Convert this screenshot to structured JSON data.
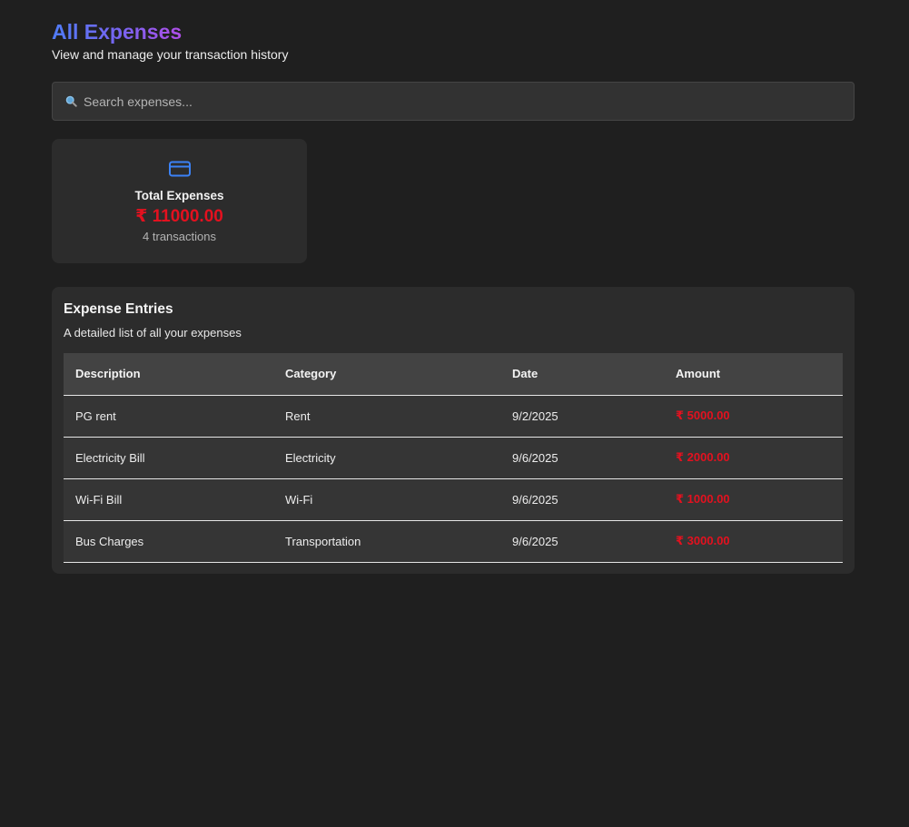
{
  "header": {
    "title": "All Expenses",
    "subtitle": "View and manage your transaction history"
  },
  "search": {
    "icon": "search-icon",
    "placeholder": "Search expenses..."
  },
  "summary": {
    "icon": "credit-card-icon",
    "title": "Total Expenses",
    "amount": "₹ 11000.00",
    "count": "4 transactions"
  },
  "entries": {
    "title": "Expense Entries",
    "subtitle": "A detailed list of all your expenses",
    "columns": [
      "Description",
      "Category",
      "Date",
      "Amount"
    ],
    "rows": [
      {
        "description": "PG rent",
        "category": "Rent",
        "date": "9/2/2025",
        "amount": "₹ 5000.00"
      },
      {
        "description": "Electricity Bill",
        "category": "Electricity",
        "date": "9/6/2025",
        "amount": "₹ 2000.00"
      },
      {
        "description": "Wi-Fi Bill",
        "category": "Wi-Fi",
        "date": "9/6/2025",
        "amount": "₹ 1000.00"
      },
      {
        "description": "Bus Charges",
        "category": "Transportation",
        "date": "9/6/2025",
        "amount": "₹ 3000.00"
      }
    ]
  },
  "colors": {
    "background": "#1f1f1f",
    "card": "#2c2c2c",
    "amount_red": "#e3111f",
    "accent_blue": "#3b82f6",
    "title_gradient": [
      "#4f7cf6",
      "#b04ee8"
    ]
  }
}
